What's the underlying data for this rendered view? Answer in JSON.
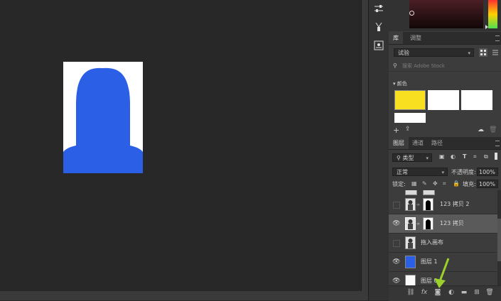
{
  "panel_tabs_top": {
    "library": "库",
    "adjust": "调整"
  },
  "library": {
    "dropdown_value": "试验",
    "search_placeholder": "搜索 Adobe Stock",
    "section_label": "颜色"
  },
  "colors": {
    "swatches": [
      "#f8df1f",
      "#ffffff",
      "#ffffff",
      "#ffffff",
      "#ffffff"
    ],
    "person_fill": "#2a5fe6"
  },
  "layers_tabs": {
    "layers": "图层",
    "channels": "通道",
    "paths": "路径"
  },
  "layers_filter": {
    "kind_label": "类型"
  },
  "blend": {
    "mode": "正常",
    "opacity_label": "不透明度:",
    "opacity_value": "100%",
    "lock_label": "锁定:",
    "fill_label": "填充:",
    "fill_value": "100%"
  },
  "layers": [
    {
      "name": "123 拷贝 2",
      "visible": false,
      "selected": false,
      "has_mask": true
    },
    {
      "name": "123 拷贝",
      "visible": true,
      "selected": true,
      "has_mask": true
    },
    {
      "name": "拖入画布",
      "visible": false,
      "selected": false,
      "has_mask": false
    },
    {
      "name": "图层 1",
      "visible": true,
      "selected": false,
      "has_mask": false
    },
    {
      "name": "图层 0",
      "visible": true,
      "selected": false,
      "has_mask": false
    }
  ],
  "icons": {
    "tool_1": "sliders-icon",
    "tool_2": "brush-icon",
    "tool_3": "properties-icon",
    "footer": [
      "link-icon",
      "fx-icon",
      "mask-icon",
      "adjustment-icon",
      "folder-icon",
      "new-layer-icon",
      "trash-icon"
    ]
  }
}
